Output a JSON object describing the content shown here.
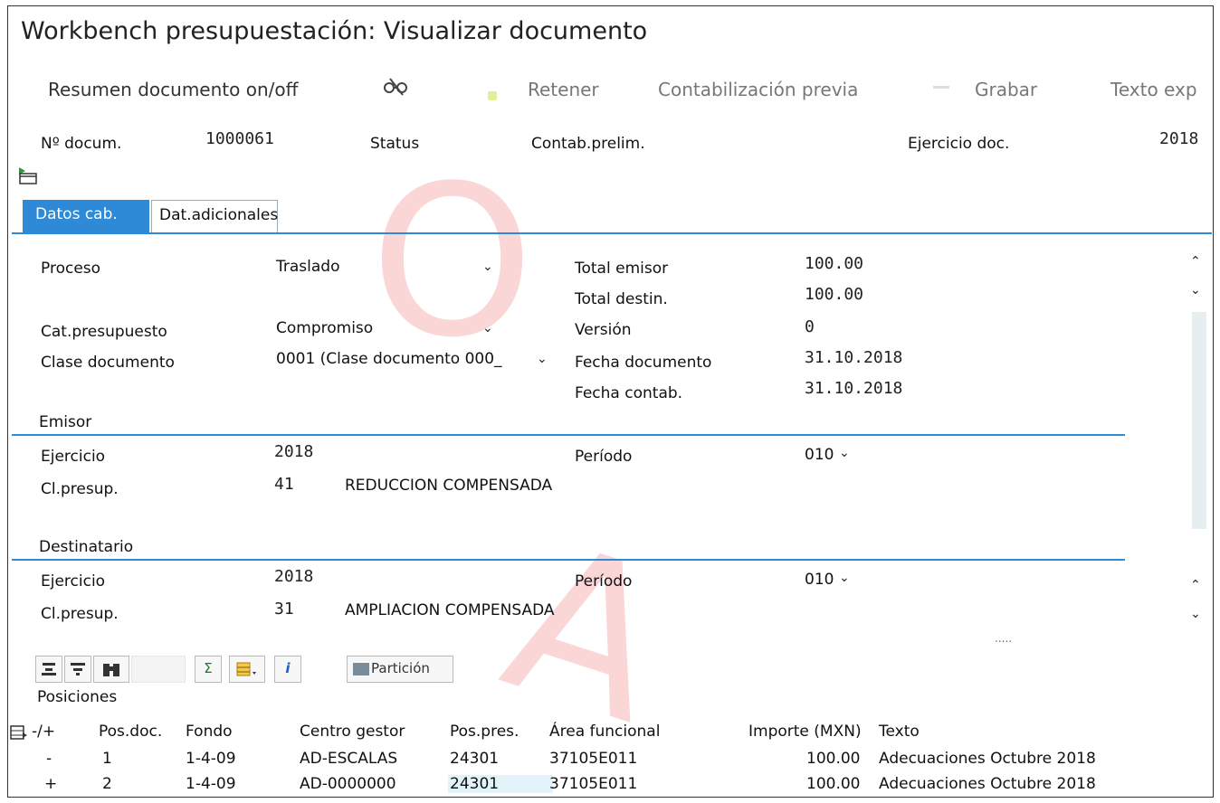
{
  "window": {
    "title": "Workbench presupuestación: Visualizar documento"
  },
  "toolbar": {
    "summary_toggle": "Resumen documento on/off",
    "retener": "Retener",
    "contab_previa": "Contabilización previa",
    "grabar": "Grabar",
    "texto": "Texto exp"
  },
  "header": {
    "doc_label": "Nº docum.",
    "doc_value": "1000061",
    "status_label": "Status",
    "status_value": "Contab.prelim.",
    "ejercicio_label": "Ejercicio doc.",
    "ejercicio_value": "2018"
  },
  "tabs": [
    {
      "label": "Datos cab.",
      "active": true
    },
    {
      "label": "Dat.adicionales",
      "active": false
    }
  ],
  "form": {
    "proceso_label": "Proceso",
    "proceso_value": "Traslado",
    "cat_label": "Cat.presupuesto",
    "cat_value": "Compromiso",
    "clase_label": "Clase documento",
    "clase_value": "0001 (Clase documento 000_",
    "total_emisor_label": "Total emisor",
    "total_emisor_value": "100.00",
    "total_destin_label": "Total destin.",
    "total_destin_value": "100.00",
    "version_label": "Versión",
    "version_value": "0",
    "fecha_doc_label": "Fecha documento",
    "fecha_doc_value": "31.10.2018",
    "fecha_contab_label": "Fecha contab.",
    "fecha_contab_value": "31.10.2018"
  },
  "emisor": {
    "section": "Emisor",
    "ejercicio_label": "Ejercicio",
    "ejercicio_value": "2018",
    "periodo_label": "Período",
    "periodo_value": "010",
    "clpres_label": "Cl.presup.",
    "clpres_code": "41",
    "clpres_text": "REDUCCION COMPENSADA"
  },
  "destinatario": {
    "section": "Destinatario",
    "ejercicio_label": "Ejercicio",
    "ejercicio_value": "2018",
    "periodo_label": "Período",
    "periodo_value": "010",
    "clpres_label": "Cl.presup.",
    "clpres_code": "31",
    "clpres_text": "AMPLIACION COMPENSADA"
  },
  "grid_toolbar": {
    "particion": "Partición",
    "sum_symbol": "Σ",
    "info_symbol": "i"
  },
  "positions": {
    "title": "Posiciones",
    "columns": [
      "-/+",
      "Pos.doc.",
      "Fondo",
      "Centro gestor",
      "Pos.pres.",
      "Área funcional",
      "Importe (MXN)",
      "Texto"
    ],
    "rows": [
      {
        "sign": "-",
        "pos": "1",
        "fondo": "1-4-09",
        "centro": "AD-ESCALAS",
        "pospres": "24301",
        "area": "37105E011",
        "importe": "100.00",
        "texto": "Adecuaciones Octubre 2018"
      },
      {
        "sign": "+",
        "pos": "2",
        "fondo": "1-4-09",
        "centro": "AD-0000000",
        "pospres": "24301",
        "area": "37105E011",
        "importe": "100.00",
        "texto": "Adecuaciones Octubre 2018"
      }
    ]
  },
  "colors": {
    "accent": "#2e8ad6",
    "watermark": "#e64646"
  }
}
